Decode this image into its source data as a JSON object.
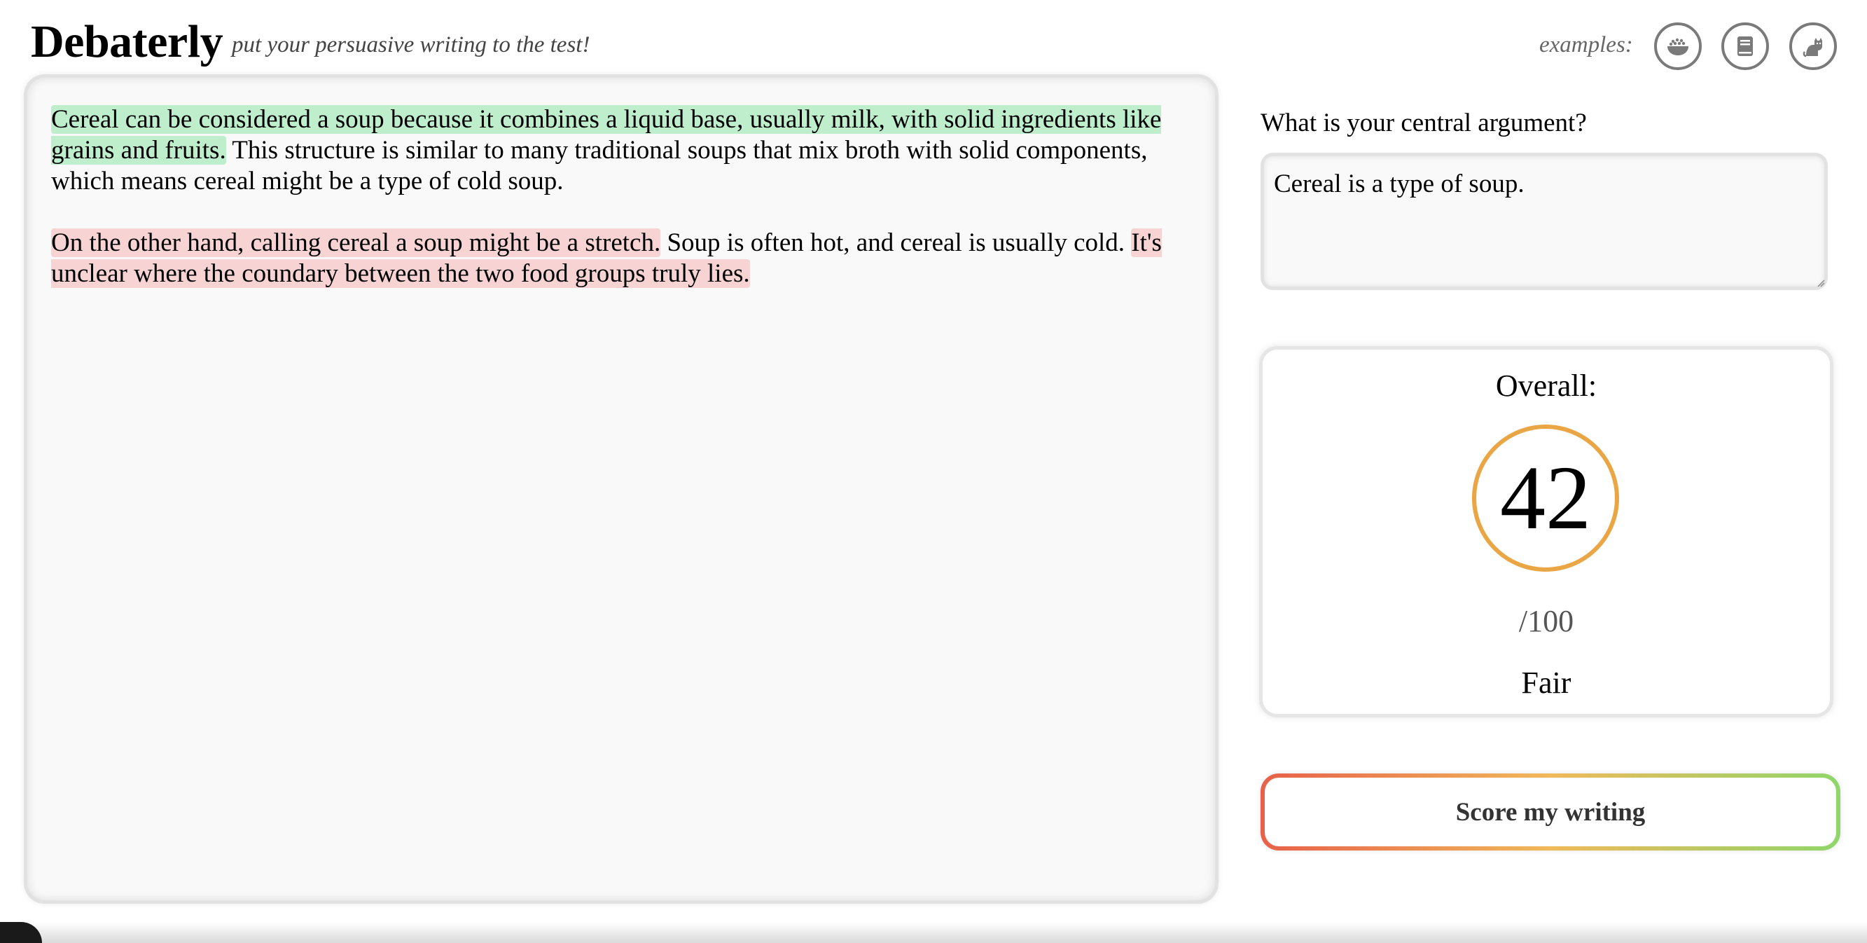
{
  "header": {
    "brand": "Debaterly",
    "tagline": "put your persuasive writing to the test!",
    "examples_label": "examples:",
    "examples": [
      {
        "icon": "cereal-bowl-icon"
      },
      {
        "icon": "book-icon"
      },
      {
        "icon": "cat-icon"
      }
    ]
  },
  "editor": {
    "paragraphs": [
      {
        "segments": [
          {
            "text": "Cereal can be considered a soup because it combines a liquid base, usually milk, with solid ingredients like grains and fruits.",
            "highlight": "green"
          },
          {
            "text": " This structure is similar to many traditional soups that mix broth with solid components, which means cereal might be a type of cold soup.",
            "highlight": "none"
          }
        ]
      },
      {
        "segments": [
          {
            "text": "On the other hand, calling cereal a soup might be a stretch.",
            "highlight": "red"
          },
          {
            "text": " Soup is often hot, and cereal is usually cold. ",
            "highlight": "none"
          },
          {
            "text": "It's unclear where the coundary between the two food groups truly lies.",
            "highlight": "red"
          }
        ]
      }
    ]
  },
  "argument": {
    "question": "What is your central argument?",
    "value": "Cereal is a type of soup."
  },
  "score": {
    "title": "Overall:",
    "value": "42",
    "max": "/100",
    "rating": "Fair",
    "ring_color": "#eaa644"
  },
  "actions": {
    "score_button": "Score my writing"
  },
  "colors": {
    "highlight_green": "#bfeecd",
    "highlight_red": "#f7d3d3",
    "button_gradient": [
      "#e8604a",
      "#f0b95a",
      "#8fd66a"
    ]
  }
}
